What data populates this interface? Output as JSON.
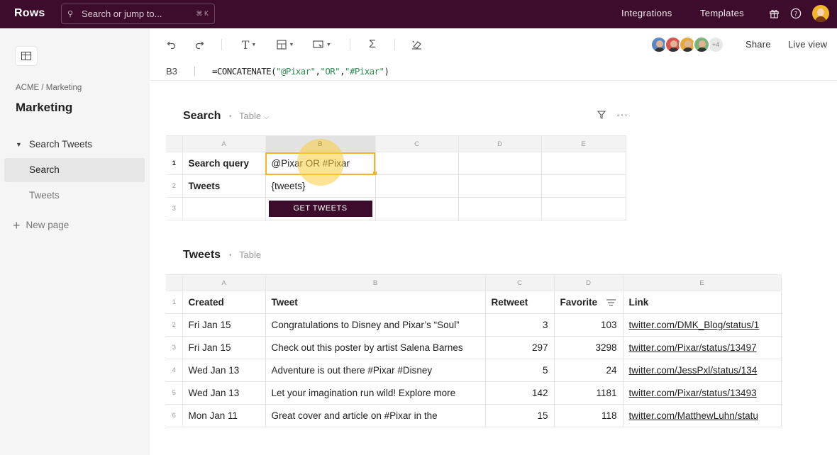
{
  "topbar": {
    "logo": "Rows",
    "search_placeholder": "Search or jump to...",
    "search_shortcut": "⌘ K",
    "integrations": "Integrations",
    "templates": "Templates"
  },
  "sidebar": {
    "breadcrumb": "ACME / Marketing",
    "title": "Marketing",
    "group": "Search Tweets",
    "items": [
      {
        "label": "Search"
      },
      {
        "label": "Tweets"
      }
    ],
    "new_page": "New page"
  },
  "toolbar": {
    "collaborators_more": "+4",
    "share": "Share",
    "live_view": "Live view"
  },
  "formula_bar": {
    "cell": "B3",
    "prefix": "=CONCATENATE(",
    "arg1": "\"@Pixar\"",
    "arg2": "\"OR\"",
    "arg3": "\"#Pixar\"",
    "suffix": ")"
  },
  "search_table": {
    "title": "Search",
    "type": "Table",
    "columns": [
      "A",
      "B",
      "C",
      "D",
      "E"
    ],
    "rows": [
      {
        "n": "1",
        "a": "Search query",
        "b": "@Pixar OR #Pixar"
      },
      {
        "n": "2",
        "a": "Tweets",
        "b": "{tweets}"
      },
      {
        "n": "3",
        "a": "",
        "b": "GET TWEETS"
      }
    ]
  },
  "tweets_table": {
    "title": "Tweets",
    "type": "Table",
    "columns": [
      "A",
      "B",
      "C",
      "D",
      "E"
    ],
    "headers": [
      "Created",
      "Tweet",
      "Retweet",
      "Favorite",
      "Link"
    ],
    "rows": [
      {
        "n": "2",
        "created": "Fri Jan 15",
        "tweet": "Congratulations to Disney and Pixar’s “Soul”",
        "retweet": "3",
        "favorite": "103",
        "link": "twitter.com/DMK_Blog/status/1"
      },
      {
        "n": "3",
        "created": "Fri Jan 15",
        "tweet": "Check out this poster by artist Salena Barnes",
        "retweet": "297",
        "favorite": "3298",
        "link": "twitter.com/Pixar/status/13497"
      },
      {
        "n": "4",
        "created": "Wed Jan 13",
        "tweet": "Adventure is out there #Pixar #Disney",
        "retweet": "5",
        "favorite": "24",
        "link": "twitter.com/JessPxl/status/134"
      },
      {
        "n": "5",
        "created": "Wed Jan 13",
        "tweet": "Let your imagination run wild! Explore more",
        "retweet": "142",
        "favorite": "1181",
        "link": "twitter.com/Pixar/status/13493"
      },
      {
        "n": "6",
        "created": "Mon Jan 11",
        "tweet": "Great cover and article on #Pixar in the",
        "retweet": "15",
        "favorite": "118",
        "link": "twitter.com/MatthewLuhn/statu"
      }
    ]
  },
  "colors": {
    "brand": "#3d0c2c",
    "selection": "#f2b524",
    "formula_string": "#2e8c55"
  }
}
